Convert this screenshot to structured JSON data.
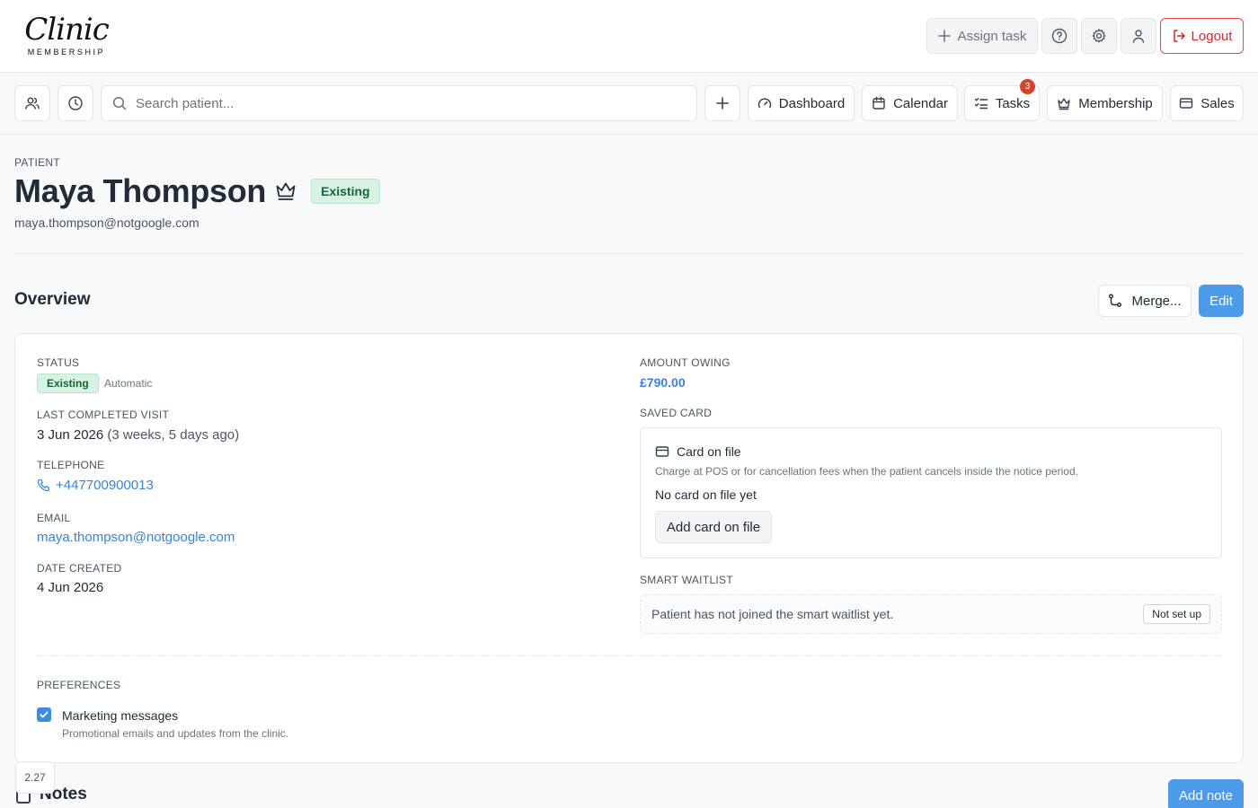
{
  "brand": {
    "script": "Clinic",
    "sub": "MEMBERSHIP"
  },
  "header": {
    "assign_task": "Assign task",
    "logout": "Logout",
    "icons": [
      "help-icon",
      "settings-gear-icon",
      "user-icon",
      "logout-icon"
    ]
  },
  "nav": {
    "search_placeholder": "Search patient...",
    "items": [
      {
        "label": "Dashboard",
        "icon": "gauge-icon"
      },
      {
        "label": "Calendar",
        "icon": "calendar-icon"
      },
      {
        "label": "Tasks",
        "icon": "checklist-icon",
        "badge": "3"
      },
      {
        "label": "Membership",
        "icon": "crown-icon"
      },
      {
        "label": "Sales",
        "icon": "credit-card-icon"
      }
    ]
  },
  "patient": {
    "eyebrow": "PATIENT",
    "name": "Maya Thompson",
    "status_pill": "Existing",
    "email": "maya.thompson@notgoogle.com"
  },
  "overview": {
    "title": "Overview",
    "merge": "Merge...",
    "edit": "Edit",
    "status_label": "STATUS",
    "status_value": "Existing",
    "status_mode": "Automatic",
    "last_visit_label": "LAST COMPLETED VISIT",
    "last_visit_date": "3 Jun 2026",
    "last_visit_relative": "(3 weeks, 5 days ago)",
    "telephone_label": "TELEPHONE",
    "telephone": "+447700900013",
    "email_label": "EMAIL",
    "email": "maya.thompson@notgoogle.com",
    "date_created_label": "DATE CREATED",
    "date_created": "4 Jun 2026",
    "amount_owing_label": "AMOUNT OWING",
    "amount_owing": "£790.00",
    "saved_card_label": "SAVED CARD",
    "card_title": "Card on file",
    "card_desc": "Charge at POS or for cancellation fees when the patient cancels inside the notice period.",
    "card_status": "No card on file yet",
    "add_card": "Add card on file",
    "waitlist_label": "SMART WAITLIST",
    "waitlist_text": "Patient has not joined the smart waitlist yet.",
    "waitlist_badge": "Not set up",
    "preferences_label": "PREFERENCES",
    "marketing_label": "Marketing messages",
    "marketing_desc": "Promotional emails and updates from the clinic.",
    "marketing_checked": true
  },
  "notes": {
    "title": "Notes",
    "add": "Add note"
  },
  "version": "2.27",
  "colors": {
    "primary": "#4d9be8",
    "danger": "#dc2626",
    "success_bg": "#d8f3e4",
    "success_fg": "#166534",
    "badge": "#d6422c"
  }
}
